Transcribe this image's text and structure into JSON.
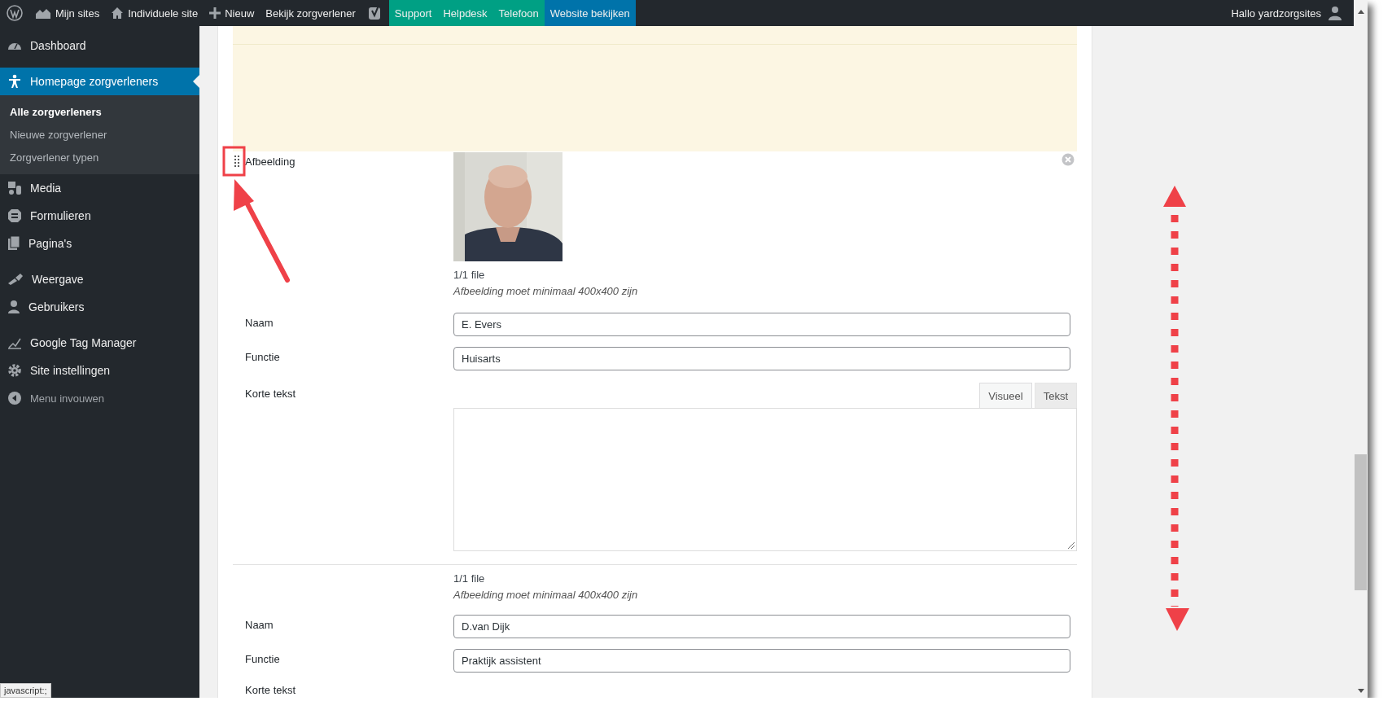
{
  "admin_bar": {
    "left": [
      {
        "kind": "logo"
      },
      {
        "label": "Mijn sites"
      },
      {
        "label": "Individuele site"
      },
      {
        "label": "Nieuw"
      },
      {
        "label": "Bekijk zorgverlener"
      },
      {
        "kind": "logo"
      },
      {
        "label": "Support",
        "color": "#00a084"
      },
      {
        "label": "Helpdesk",
        "color": "#00a084"
      },
      {
        "label": "Telefoon",
        "color": "#00a084"
      },
      {
        "label": "Website bekijken",
        "color": "#0073aa"
      }
    ],
    "greeting": "Hallo yardzorgsites"
  },
  "sidebar": {
    "groups": [
      [
        {
          "kind": "menu",
          "label": "Dashboard",
          "selected": false
        }
      ],
      [
        {
          "kind": "menu",
          "label": "Homepage zorgverleners",
          "selected": true,
          "children": [
            {
              "label": "Alle zorgverleners",
              "selected": true
            },
            {
              "label": "Nieuwe zorgverlener",
              "selected": false
            },
            {
              "label": "Zorgverlener typen",
              "selected": false
            }
          ]
        },
        {
          "kind": "menu",
          "label": "Media",
          "selected": false
        },
        {
          "kind": "menu",
          "label": "Formulieren",
          "selected": false
        },
        {
          "kind": "menu",
          "label": "Pagina's",
          "selected": false
        }
      ],
      [
        {
          "kind": "menu",
          "label": "Weergave",
          "selected": false
        },
        {
          "kind": "menu",
          "label": "Gebruikers",
          "selected": false
        }
      ],
      [
        {
          "kind": "menu",
          "label": "Google Tag Manager",
          "selected": false
        },
        {
          "kind": "menu",
          "label": "Site instellingen",
          "selected": false
        },
        {
          "kind": "collapse",
          "label": "Menu invouwen",
          "selected": false
        }
      ]
    ]
  },
  "entries": [
    {
      "hover": true,
      "image": {
        "label": "Afbeelding",
        "kind": "picture",
        "file_count": "1/1 file",
        "hint": "Afbeelding moet minimaal 400x400 zijn"
      },
      "fields": [
        {
          "label": "Naam",
          "value": "E. Evers"
        },
        {
          "label": "Functie",
          "value": "Huisarts"
        }
      ],
      "editor": {
        "label": "Korte tekst",
        "text_area": true,
        "tabs": [
          {
            "label": "Visueel",
            "selected": true
          },
          {
            "label": "Tekst",
            "selected": false
          }
        ]
      }
    },
    {
      "image": {
        "file_count": "1/1 file",
        "hint": "Afbeelding moet minimaal 400x400 zijn"
      },
      "fields": [
        {
          "label": "Naam",
          "value": "D.van Dijk"
        },
        {
          "label": "Functie",
          "value": "Praktijk assistent"
        }
      ],
      "editor": {
        "label": "Korte tekst"
      }
    }
  ],
  "status_bar": {
    "text": "javascript:;"
  }
}
